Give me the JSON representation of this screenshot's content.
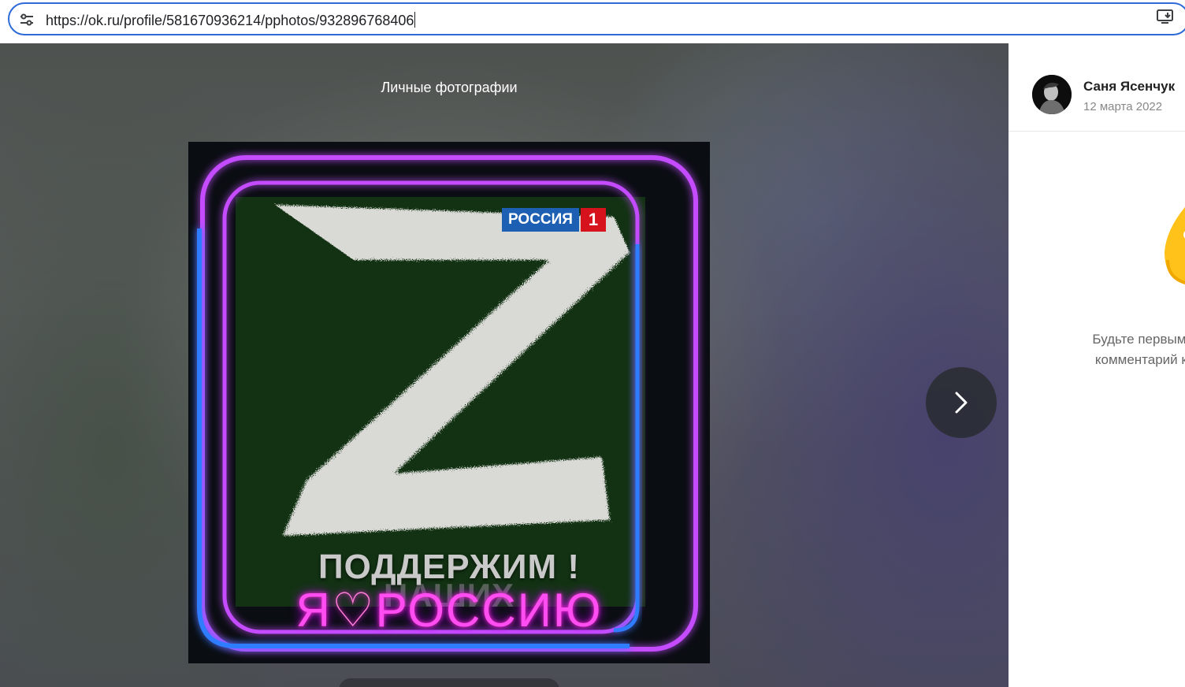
{
  "browser": {
    "url": "https://ok.ru/profile/581670936214/pphotos/932896768406",
    "site_info_icon": "tune-icon",
    "install_icon": "install-app-icon"
  },
  "viewer": {
    "album_title": "Личные фотографии",
    "next_icon": "chevron-right-icon",
    "photo": {
      "channel_logo_text": "РОССИЯ",
      "channel_logo_number": "1",
      "symbol": "Z",
      "slogan_line1": "ПОДДЕРЖИМ",
      "slogan_line2_left": "Я",
      "slogan_line2_heart": "♡",
      "slogan_line2_right": "РОССИЮ",
      "slogan_line3": "НАШИХ",
      "exclamation": "!"
    }
  },
  "side_panel": {
    "author_name": "Саня Ясенчук",
    "date": "12 марта 2022",
    "empty_comments_line1": "Будьте первым, кто оставит",
    "empty_comments_line2": "комментарий к этому фото",
    "colors": {
      "accent": "#2e6bd6",
      "illustration": "#ffc21a"
    }
  }
}
